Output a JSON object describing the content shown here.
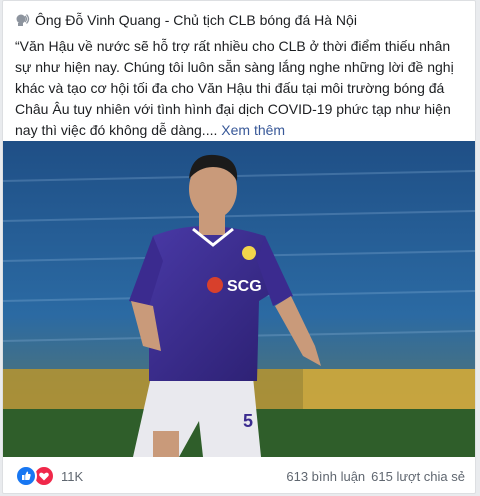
{
  "post": {
    "author_line": "Ông Đỗ Vinh Quang - Chủ tịch CLB bóng đá Hà Nội",
    "body": "“Văn Hậu về nước sẽ hỗ trợ rất nhiều cho CLB ở thời điểm thiếu nhân sự như hiện nay. Chúng tôi luôn sẵn sàng lắng nghe những lời đề nghị khác và tạo cơ hội tối đa cho Văn Hậu thi đấu tại môi trường bóng đá Châu Âu tuy nhiên với tình hình đại dịch COVID-19 phức tạp như hiện nay thì việc đó không dễ dàng....",
    "see_more": "Xem thêm",
    "photo_shirt_number": "5",
    "photo_shirt_sponsor": "SCG",
    "icon": "speaker-icon"
  },
  "footer": {
    "reaction_count": "11K",
    "comments": "613 bình luận",
    "shares": "615 lượt chia sẻ",
    "reaction_icons": [
      "like-icon",
      "love-icon"
    ]
  },
  "colors": {
    "link": "#385898",
    "like": "#1877f2",
    "love": "#f0284a",
    "shirt": "#3b2b8f",
    "pitch": "#2f5e2a"
  }
}
